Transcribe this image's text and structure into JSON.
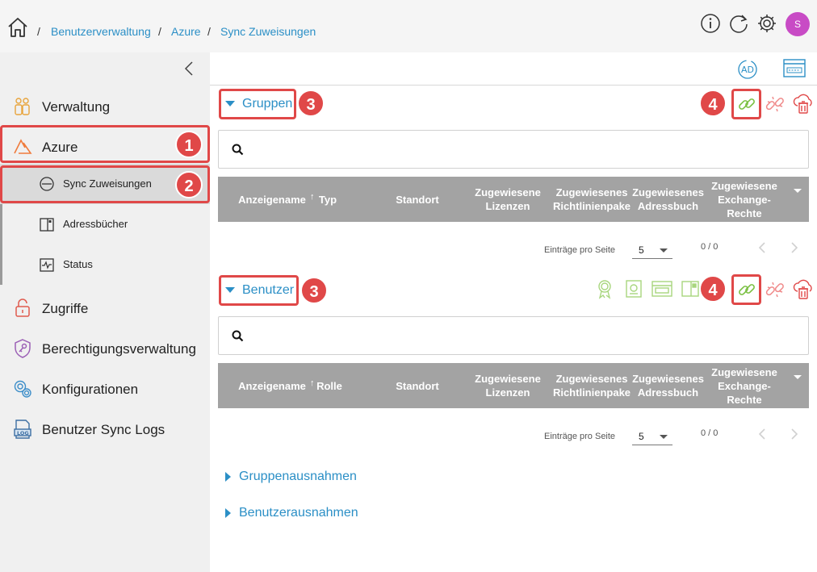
{
  "breadcrumb": {
    "items": [
      "Benutzerverwaltung",
      "Azure",
      "Sync Zuweisungen"
    ],
    "separator": "/"
  },
  "header": {
    "avatar_initial": "S"
  },
  "sidebar": {
    "items": [
      {
        "label": "Verwaltung",
        "icon": "people-icon"
      },
      {
        "label": "Azure",
        "icon": "azure-icon"
      },
      {
        "label": "Zugriffe",
        "icon": "lock-icon"
      },
      {
        "label": "Berechtigungsverwaltung",
        "icon": "shield-key-icon"
      },
      {
        "label": "Konfigurationen",
        "icon": "gears-icon"
      },
      {
        "label": "Benutzer Sync Logs",
        "icon": "log-icon"
      }
    ],
    "sub_items": [
      {
        "label": "Sync Zuweisungen",
        "icon": "sync-icon"
      },
      {
        "label": "Adressbücher",
        "icon": "address-book-icon"
      },
      {
        "label": "Status",
        "icon": "status-icon"
      }
    ]
  },
  "annotations": {
    "badge1": "1",
    "badge2": "2",
    "badge3": "3",
    "badge4": "4"
  },
  "gruppen": {
    "title": "Gruppen",
    "columns": [
      "Anzeigename",
      "Typ",
      "Standort",
      "Zugewiesene Lizenzen",
      "Zugewiesenes Richtlinienpake",
      "Zugewiesenes Adressbuch",
      "Zugewiesene Exchange-Rechte"
    ]
  },
  "benutzer": {
    "title": "Benutzer",
    "columns": [
      "Anzeigename",
      "Rolle",
      "Standort",
      "Zugewiesene Lizenzen",
      "Zugewiesenes Richtlinienpake",
      "Zugewiesenes Adressbuch",
      "Zugewiesene Exchange-Rechte"
    ]
  },
  "pager": {
    "label": "Einträge pro Seite",
    "page_size": "5",
    "range": "0 / 0"
  },
  "collapsed_sections": [
    "Gruppenausnahmen",
    "Benutzerausnahmen"
  ],
  "colors": {
    "accent": "#2b8fc6",
    "highlight": "#e04848",
    "link_green": "#7bc043",
    "danger_light": "#f08a8a",
    "avatar": "#c84bc5",
    "table_header": "#a3a3a3"
  }
}
